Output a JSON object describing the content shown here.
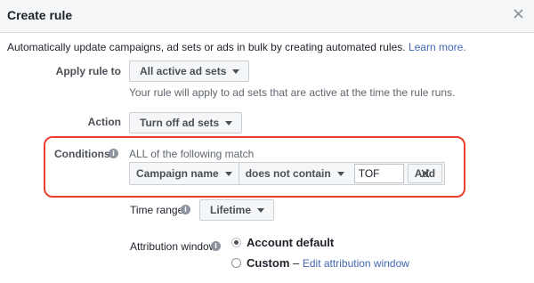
{
  "dialog": {
    "title": "Create rule",
    "close_icon": "close-icon"
  },
  "intro": {
    "text": "Automatically update campaigns, ad sets or ads in bulk by creating automated rules.",
    "link": "Learn more."
  },
  "apply_rule": {
    "label": "Apply rule to",
    "value": "All active ad sets",
    "helper": "Your rule will apply to ad sets that are active at the time the rule runs."
  },
  "action": {
    "label": "Action",
    "value": "Turn off ad sets"
  },
  "conditions": {
    "label": "Conditions",
    "match_text": "ALL of the following match",
    "field": "Campaign name",
    "operator": "does not contain",
    "input_value": "TOF",
    "add_label": "Add",
    "highlight_color": "#e8402f"
  },
  "time_range": {
    "label": "Time range",
    "value": "Lifetime"
  },
  "attribution": {
    "label": "Attribution window",
    "options": [
      {
        "label": "Account default",
        "selected": true
      },
      {
        "label": "Custom",
        "selected": false,
        "separator": "–",
        "link": "Edit attribution window"
      }
    ]
  },
  "colors": {
    "link": "#4267b2",
    "header_bg": "#f5f6f7"
  }
}
